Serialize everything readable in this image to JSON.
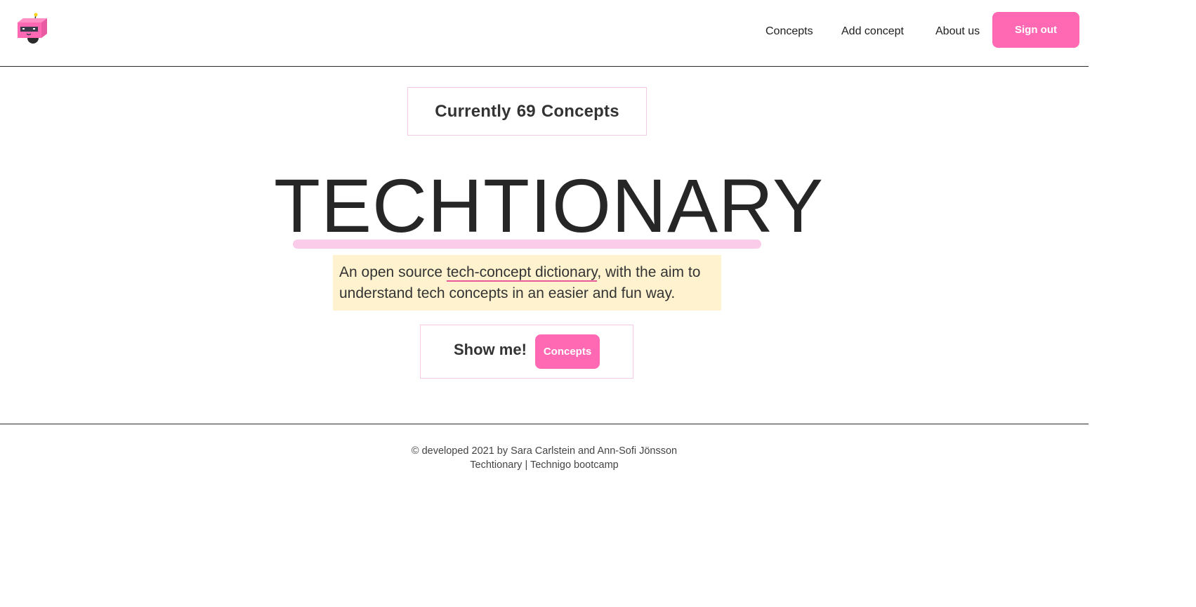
{
  "header": {
    "nav": {
      "concepts": "Concepts",
      "add_concept": "Add concept",
      "about_us": "About us"
    },
    "sign_out_label": "Sign out"
  },
  "counter": {
    "prefix": "Currently",
    "count": "69",
    "suffix": "Concepts"
  },
  "hero": {
    "title": "TECHTIONARY",
    "tagline_before": "An open source ",
    "tagline_highlight": "tech-concept dictionary",
    "tagline_after": ", with the aim to understand tech concepts in an easier and fun way."
  },
  "cta": {
    "label": "Show me!",
    "button_label": "Concepts"
  },
  "footer": {
    "line1": "© developed 2021 by Sara Carlstein and Ann-Sofi Jönsson",
    "line2": "Techtionary | Technigo bootcamp"
  },
  "colors": {
    "accent": "#ff69b4",
    "underline": "#fbcbea",
    "tagline_bg": "#fff3cf",
    "box_border": "#f6c9e6"
  },
  "icons": {
    "logo": "robot-logo-icon"
  }
}
